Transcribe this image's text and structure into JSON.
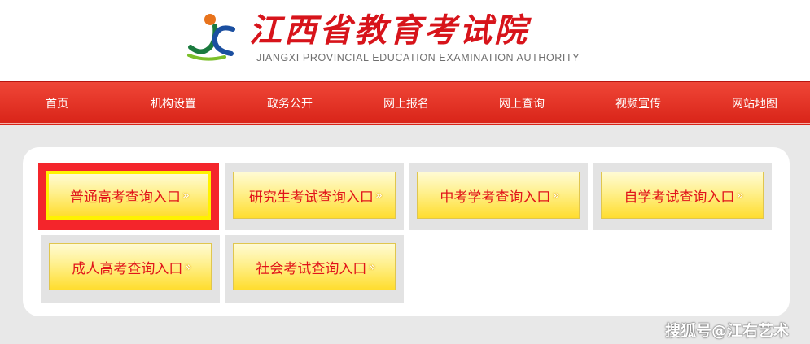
{
  "header": {
    "title": "江西省教育考试院",
    "subtitle": "JIANGXI PROVINCIAL EDUCATION EXAMINATION AUTHORITY"
  },
  "nav": {
    "items": [
      {
        "label": "首页"
      },
      {
        "label": "机构设置"
      },
      {
        "label": "政务公开"
      },
      {
        "label": "网上报名"
      },
      {
        "label": "网上查询"
      },
      {
        "label": "视频宣传"
      },
      {
        "label": "网站地图"
      }
    ]
  },
  "entries": [
    {
      "label": "普通高考查询入口",
      "highlighted": true
    },
    {
      "label": "研究生考试查询入口",
      "highlighted": false
    },
    {
      "label": "中考学考查询入口",
      "highlighted": false
    },
    {
      "label": "自学考试查询入口",
      "highlighted": false
    },
    {
      "label": "成人高考查询入口",
      "highlighted": false
    },
    {
      "label": "社会考试查询入口",
      "highlighted": false
    }
  ],
  "chevron": "»",
  "watermark": "搜狐号@江右艺术",
  "colors": {
    "brand_red": "#d7141b",
    "nav_red": "#e53a2d",
    "button_yellow": "#ffe64a",
    "highlight_red": "#f4252b",
    "highlight_yellow": "#fff200"
  }
}
